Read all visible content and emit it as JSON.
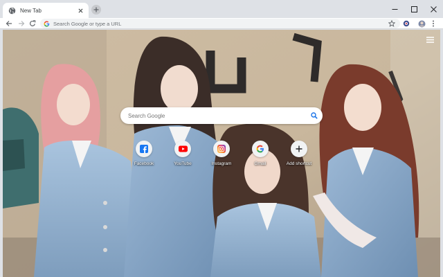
{
  "tab": {
    "title": "New Tab"
  },
  "omnibox": {
    "placeholder": "Search Google or type a URL"
  },
  "search": {
    "placeholder": "Search Google"
  },
  "shortcuts": [
    {
      "label": "Facebook",
      "icon": "facebook-icon",
      "color": "#1877f2"
    },
    {
      "label": "YouTube",
      "icon": "youtube-icon",
      "color": "#ff0000"
    },
    {
      "label": "Instagram",
      "icon": "instagram-icon",
      "color": "#c13584"
    },
    {
      "label": "Gmail",
      "icon": "google-icon",
      "color": "#4285f4"
    },
    {
      "label": "Add shortcut",
      "icon": "plus-icon",
      "color": "#202124"
    }
  ],
  "colors": {
    "tabstrip": "#dee1e6",
    "toolbar": "#ffffff",
    "omnibox": "#f1f3f4",
    "accent": "#1a73e8"
  }
}
